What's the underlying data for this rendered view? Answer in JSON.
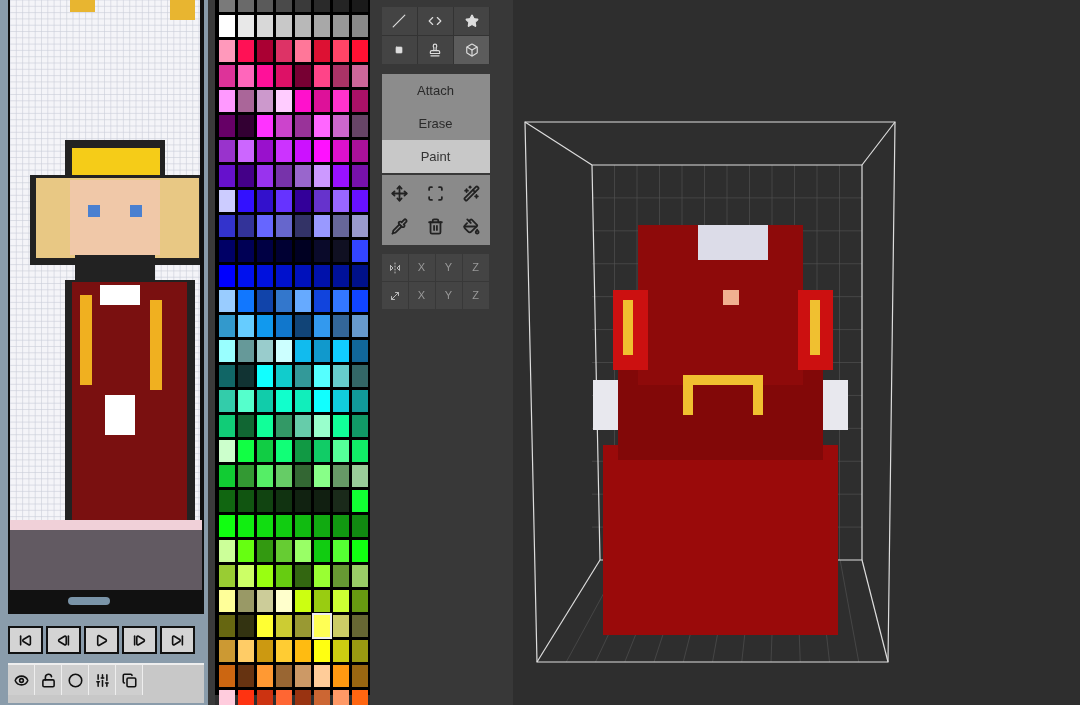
{
  "playback": [
    {
      "kind": "first"
    },
    {
      "kind": "prev"
    },
    {
      "kind": "play"
    },
    {
      "kind": "next"
    },
    {
      "kind": "last"
    }
  ],
  "layer_tools": [
    {
      "kind": "eye"
    },
    {
      "kind": "lock"
    },
    {
      "kind": "onion"
    },
    {
      "kind": "sliders"
    },
    {
      "kind": "duplicate"
    }
  ],
  "palette": {
    "rows": [
      {
        "swatches": [
          {
            "color": "#7a7a7a",
            "selected": false
          },
          {
            "color": "#6a6a6a",
            "selected": false
          },
          {
            "color": "#5a5a5a",
            "selected": false
          },
          {
            "color": "#4a4a4a",
            "selected": false
          },
          {
            "color": "#3a3a3a",
            "selected": false
          },
          {
            "color": "#2a2a2a",
            "selected": false
          },
          {
            "color": "#242424",
            "selected": false
          },
          {
            "color": "#1a1a1a",
            "selected": false
          }
        ]
      },
      {
        "swatches": [
          {
            "color": "#ffffff",
            "selected": false
          },
          {
            "color": "#e8e8e8",
            "selected": false
          },
          {
            "color": "#d8d8d8",
            "selected": false
          },
          {
            "color": "#c8c8c8",
            "selected": false
          },
          {
            "color": "#b8b8b8",
            "selected": false
          },
          {
            "color": "#a8a8a8",
            "selected": false
          },
          {
            "color": "#989898",
            "selected": false
          },
          {
            "color": "#888888",
            "selected": false
          }
        ]
      },
      {
        "swatches": [
          {
            "color": "#ff99bb",
            "selected": false
          },
          {
            "color": "#ff1155",
            "selected": false
          },
          {
            "color": "#aa0033",
            "selected": false
          },
          {
            "color": "#dd3366",
            "selected": false
          },
          {
            "color": "#ff7799",
            "selected": false
          },
          {
            "color": "#dd1133",
            "selected": false
          },
          {
            "color": "#ff4466",
            "selected": false
          },
          {
            "color": "#ff1133",
            "selected": false
          }
        ]
      },
      {
        "swatches": [
          {
            "color": "#dd3399",
            "selected": false
          },
          {
            "color": "#ff66bb",
            "selected": false
          },
          {
            "color": "#ff1199",
            "selected": false
          },
          {
            "color": "#dd1166",
            "selected": false
          },
          {
            "color": "#770033",
            "selected": false
          },
          {
            "color": "#ff4488",
            "selected": false
          },
          {
            "color": "#aa3366",
            "selected": false
          },
          {
            "color": "#cc6699",
            "selected": false
          }
        ]
      },
      {
        "swatches": [
          {
            "color": "#ff99ff",
            "selected": false
          },
          {
            "color": "#aa6699",
            "selected": false
          },
          {
            "color": "#cc99cc",
            "selected": false
          },
          {
            "color": "#ffccff",
            "selected": false
          },
          {
            "color": "#ff11cc",
            "selected": false
          },
          {
            "color": "#dd1199",
            "selected": false
          },
          {
            "color": "#ff33cc",
            "selected": false
          },
          {
            "color": "#aa1166",
            "selected": false
          }
        ]
      },
      {
        "swatches": [
          {
            "color": "#660066",
            "selected": false
          },
          {
            "color": "#330033",
            "selected": false
          },
          {
            "color": "#ff33ff",
            "selected": false
          },
          {
            "color": "#cc44cc",
            "selected": false
          },
          {
            "color": "#993399",
            "selected": false
          },
          {
            "color": "#ff66ff",
            "selected": false
          },
          {
            "color": "#cc66cc",
            "selected": false
          },
          {
            "color": "#664466",
            "selected": false
          }
        ]
      },
      {
        "swatches": [
          {
            "color": "#9933cc",
            "selected": false
          },
          {
            "color": "#cc66ff",
            "selected": false
          },
          {
            "color": "#9911cc",
            "selected": false
          },
          {
            "color": "#cc33ff",
            "selected": false
          },
          {
            "color": "#cc11ff",
            "selected": false
          },
          {
            "color": "#ff11ff",
            "selected": false
          },
          {
            "color": "#dd11cc",
            "selected": false
          },
          {
            "color": "#aa1199",
            "selected": false
          }
        ]
      },
      {
        "swatches": [
          {
            "color": "#6611cc",
            "selected": false
          },
          {
            "color": "#440088",
            "selected": false
          },
          {
            "color": "#9933ee",
            "selected": false
          },
          {
            "color": "#7733aa",
            "selected": false
          },
          {
            "color": "#9966cc",
            "selected": false
          },
          {
            "color": "#cc99ff",
            "selected": false
          },
          {
            "color": "#9911ff",
            "selected": false
          },
          {
            "color": "#7711aa",
            "selected": false
          }
        ]
      },
      {
        "swatches": [
          {
            "color": "#ccccff",
            "selected": false
          },
          {
            "color": "#3311ff",
            "selected": false
          },
          {
            "color": "#3311cc",
            "selected": false
          },
          {
            "color": "#6633ff",
            "selected": false
          },
          {
            "color": "#330099",
            "selected": false
          },
          {
            "color": "#6633cc",
            "selected": false
          },
          {
            "color": "#9966ff",
            "selected": false
          },
          {
            "color": "#6611ff",
            "selected": false
          }
        ]
      },
      {
        "swatches": [
          {
            "color": "#3333cc",
            "selected": false
          },
          {
            "color": "#333399",
            "selected": false
          },
          {
            "color": "#6666ff",
            "selected": false
          },
          {
            "color": "#6666cc",
            "selected": false
          },
          {
            "color": "#333366",
            "selected": false
          },
          {
            "color": "#9999ff",
            "selected": false
          },
          {
            "color": "#666699",
            "selected": false
          },
          {
            "color": "#9999cc",
            "selected": false
          }
        ]
      },
      {
        "swatches": [
          {
            "color": "#000066",
            "selected": false
          },
          {
            "color": "#000055",
            "selected": false
          },
          {
            "color": "#000044",
            "selected": false
          },
          {
            "color": "#000033",
            "selected": false
          },
          {
            "color": "#000022",
            "selected": false
          },
          {
            "color": "#0a0a2a",
            "selected": false
          },
          {
            "color": "#101022",
            "selected": false
          },
          {
            "color": "#3344ff",
            "selected": false
          }
        ]
      },
      {
        "swatches": [
          {
            "color": "#0000ff",
            "selected": false
          },
          {
            "color": "#0011ee",
            "selected": false
          },
          {
            "color": "#0011dd",
            "selected": false
          },
          {
            "color": "#0011cc",
            "selected": false
          },
          {
            "color": "#0011bb",
            "selected": false
          },
          {
            "color": "#0011aa",
            "selected": false
          },
          {
            "color": "#001199",
            "selected": false
          },
          {
            "color": "#001188",
            "selected": false
          }
        ]
      },
      {
        "swatches": [
          {
            "color": "#99ccff",
            "selected": false
          },
          {
            "color": "#1177ff",
            "selected": false
          },
          {
            "color": "#1144aa",
            "selected": false
          },
          {
            "color": "#3377cc",
            "selected": false
          },
          {
            "color": "#66aaff",
            "selected": false
          },
          {
            "color": "#1144dd",
            "selected": false
          },
          {
            "color": "#3377ff",
            "selected": false
          },
          {
            "color": "#1144ff",
            "selected": false
          }
        ]
      },
      {
        "swatches": [
          {
            "color": "#3399cc",
            "selected": false
          },
          {
            "color": "#66ccff",
            "selected": false
          },
          {
            "color": "#1199ee",
            "selected": false
          },
          {
            "color": "#1177cc",
            "selected": false
          },
          {
            "color": "#114477",
            "selected": false
          },
          {
            "color": "#3399ee",
            "selected": false
          },
          {
            "color": "#336699",
            "selected": false
          },
          {
            "color": "#6699cc",
            "selected": false
          }
        ]
      },
      {
        "swatches": [
          {
            "color": "#99ffff",
            "selected": false
          },
          {
            "color": "#669999",
            "selected": false
          },
          {
            "color": "#99cccc",
            "selected": false
          },
          {
            "color": "#ccffff",
            "selected": false
          },
          {
            "color": "#11bbee",
            "selected": false
          },
          {
            "color": "#1199cc",
            "selected": false
          },
          {
            "color": "#11ccff",
            "selected": false
          },
          {
            "color": "#116699",
            "selected": false
          }
        ]
      },
      {
        "swatches": [
          {
            "color": "#116666",
            "selected": false
          },
          {
            "color": "#113333",
            "selected": false
          },
          {
            "color": "#11ffff",
            "selected": false
          },
          {
            "color": "#11cccc",
            "selected": false
          },
          {
            "color": "#339999",
            "selected": false
          },
          {
            "color": "#55ffff",
            "selected": false
          },
          {
            "color": "#66cccc",
            "selected": false
          },
          {
            "color": "#336666",
            "selected": false
          }
        ]
      },
      {
        "swatches": [
          {
            "color": "#33ccaa",
            "selected": false
          },
          {
            "color": "#55ffcc",
            "selected": false
          },
          {
            "color": "#11ccaa",
            "selected": false
          },
          {
            "color": "#11ffcc",
            "selected": false
          },
          {
            "color": "#11eebb",
            "selected": false
          },
          {
            "color": "#11ffff",
            "selected": false
          },
          {
            "color": "#11ccdd",
            "selected": false
          },
          {
            "color": "#119999",
            "selected": false
          }
        ]
      },
      {
        "swatches": [
          {
            "color": "#11cc77",
            "selected": false
          },
          {
            "color": "#116633",
            "selected": false
          },
          {
            "color": "#11ff99",
            "selected": false
          },
          {
            "color": "#339966",
            "selected": false
          },
          {
            "color": "#66ccaa",
            "selected": false
          },
          {
            "color": "#99ffcc",
            "selected": false
          },
          {
            "color": "#11ff99",
            "selected": false
          },
          {
            "color": "#119966",
            "selected": false
          }
        ]
      },
      {
        "swatches": [
          {
            "color": "#ccffcc",
            "selected": false
          },
          {
            "color": "#11ff44",
            "selected": false
          },
          {
            "color": "#11cc44",
            "selected": false
          },
          {
            "color": "#11ff77",
            "selected": false
          },
          {
            "color": "#119944",
            "selected": false
          },
          {
            "color": "#11cc66",
            "selected": false
          },
          {
            "color": "#55ff99",
            "selected": false
          },
          {
            "color": "#11ee66",
            "selected": false
          }
        ]
      },
      {
        "swatches": [
          {
            "color": "#11cc33",
            "selected": false
          },
          {
            "color": "#339933",
            "selected": false
          },
          {
            "color": "#55ee66",
            "selected": false
          },
          {
            "color": "#66cc66",
            "selected": false
          },
          {
            "color": "#336633",
            "selected": false
          },
          {
            "color": "#88ff88",
            "selected": false
          },
          {
            "color": "#669966",
            "selected": false
          },
          {
            "color": "#99cc99",
            "selected": false
          }
        ]
      },
      {
        "swatches": [
          {
            "color": "#116611",
            "selected": false
          },
          {
            "color": "#115511",
            "selected": false
          },
          {
            "color": "#114411",
            "selected": false
          },
          {
            "color": "#113311",
            "selected": false
          },
          {
            "color": "#112211",
            "selected": false
          },
          {
            "color": "#111f11",
            "selected": false
          },
          {
            "color": "#1a2a1a",
            "selected": false
          },
          {
            "color": "#11ff33",
            "selected": false
          }
        ]
      },
      {
        "swatches": [
          {
            "color": "#11ff11",
            "selected": false
          },
          {
            "color": "#11ee11",
            "selected": false
          },
          {
            "color": "#11dd11",
            "selected": false
          },
          {
            "color": "#11cc11",
            "selected": false
          },
          {
            "color": "#11bb11",
            "selected": false
          },
          {
            "color": "#11aa11",
            "selected": false
          },
          {
            "color": "#119911",
            "selected": false
          },
          {
            "color": "#118811",
            "selected": false
          }
        ]
      },
      {
        "swatches": [
          {
            "color": "#ccff99",
            "selected": false
          },
          {
            "color": "#66ff11",
            "selected": false
          },
          {
            "color": "#339911",
            "selected": false
          },
          {
            "color": "#66cc33",
            "selected": false
          },
          {
            "color": "#99ff66",
            "selected": false
          },
          {
            "color": "#11cc11",
            "selected": false
          },
          {
            "color": "#55ff33",
            "selected": false
          },
          {
            "color": "#11ff11",
            "selected": false
          }
        ]
      },
      {
        "swatches": [
          {
            "color": "#99cc33",
            "selected": false
          },
          {
            "color": "#ccff66",
            "selected": false
          },
          {
            "color": "#99ff11",
            "selected": false
          },
          {
            "color": "#66cc11",
            "selected": false
          },
          {
            "color": "#336611",
            "selected": false
          },
          {
            "color": "#99ff33",
            "selected": false
          },
          {
            "color": "#669933",
            "selected": false
          },
          {
            "color": "#99cc66",
            "selected": false
          }
        ]
      },
      {
        "swatches": [
          {
            "color": "#ffff99",
            "selected": false
          },
          {
            "color": "#999966",
            "selected": false
          },
          {
            "color": "#cccc99",
            "selected": false
          },
          {
            "color": "#ffffcc",
            "selected": false
          },
          {
            "color": "#ccff11",
            "selected": false
          },
          {
            "color": "#99cc11",
            "selected": false
          },
          {
            "color": "#ccff33",
            "selected": false
          },
          {
            "color": "#669911",
            "selected": false
          }
        ]
      },
      {
        "swatches": [
          {
            "color": "#666611",
            "selected": false
          },
          {
            "color": "#333311",
            "selected": false
          },
          {
            "color": "#ffff33",
            "selected": false
          },
          {
            "color": "#cccc33",
            "selected": false
          },
          {
            "color": "#999933",
            "selected": false
          },
          {
            "color": "#ffff55",
            "selected": true
          },
          {
            "color": "#cccc66",
            "selected": false
          },
          {
            "color": "#666633",
            "selected": false
          }
        ]
      },
      {
        "swatches": [
          {
            "color": "#cc9933",
            "selected": false
          },
          {
            "color": "#ffcc66",
            "selected": false
          },
          {
            "color": "#cc9911",
            "selected": false
          },
          {
            "color": "#ffcc33",
            "selected": false
          },
          {
            "color": "#ffbb11",
            "selected": false
          },
          {
            "color": "#ffff11",
            "selected": false
          },
          {
            "color": "#cccc11",
            "selected": false
          },
          {
            "color": "#999911",
            "selected": false
          }
        ]
      },
      {
        "swatches": [
          {
            "color": "#cc6611",
            "selected": false
          },
          {
            "color": "#663311",
            "selected": false
          },
          {
            "color": "#ff9933",
            "selected": false
          },
          {
            "color": "#996633",
            "selected": false
          },
          {
            "color": "#cc9966",
            "selected": false
          },
          {
            "color": "#ffcc99",
            "selected": false
          },
          {
            "color": "#ff9911",
            "selected": false
          },
          {
            "color": "#996611",
            "selected": false
          }
        ]
      },
      {
        "swatches": [
          {
            "color": "#ffccdd",
            "selected": false
          },
          {
            "color": "#ff3311",
            "selected": false
          },
          {
            "color": "#cc3311",
            "selected": false
          },
          {
            "color": "#ff6633",
            "selected": false
          },
          {
            "color": "#993311",
            "selected": false
          },
          {
            "color": "#cc6633",
            "selected": false
          },
          {
            "color": "#ff9966",
            "selected": false
          },
          {
            "color": "#ff6611",
            "selected": false
          }
        ]
      }
    ]
  },
  "view_tools": [
    {
      "kind": "line",
      "selected": false
    },
    {
      "kind": "code",
      "selected": false
    },
    {
      "kind": "star",
      "selected": false
    },
    {
      "kind": "voxel",
      "selected": false
    },
    {
      "kind": "stamp",
      "selected": false
    },
    {
      "kind": "cube",
      "selected": true
    }
  ],
  "modes": [
    {
      "label": "Attach",
      "selected": false
    },
    {
      "label": "Erase",
      "selected": false
    },
    {
      "label": "Paint",
      "selected": true
    }
  ],
  "edit_tools": [
    {
      "kind": "move"
    },
    {
      "kind": "select"
    },
    {
      "kind": "wand"
    },
    {
      "kind": "eyedropper"
    },
    {
      "kind": "trash"
    },
    {
      "kind": "bucket"
    }
  ],
  "axis_rows": [
    {
      "kind": "mirror",
      "axes": [
        "X",
        "Y",
        "Z"
      ]
    },
    {
      "kind": "scale",
      "axes": [
        "X",
        "Y",
        "Z"
      ]
    }
  ]
}
